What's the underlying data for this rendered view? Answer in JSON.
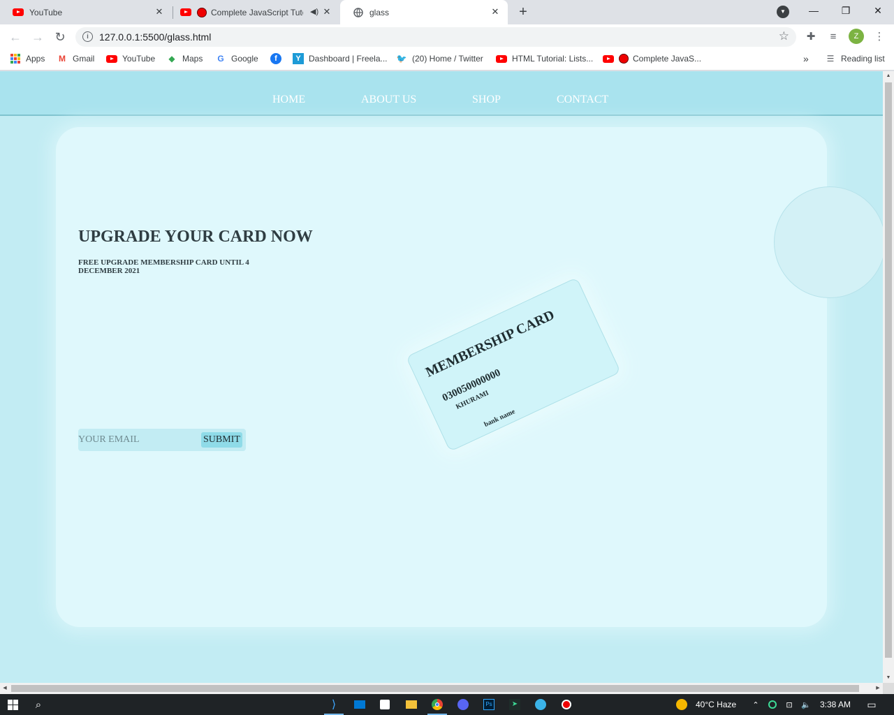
{
  "browser": {
    "tabs": [
      {
        "label": "YouTube",
        "icon": "youtube-icon"
      },
      {
        "label": "Complete JavaScript Tuto",
        "icon": "youtube-icon",
        "audio_icon": "speaker-icon"
      },
      {
        "label": "glass",
        "icon": "globe-icon",
        "active": true
      }
    ],
    "new_tab_symbol": "+",
    "url": "127.0.0.1:5500/glass.html",
    "profile_initial": "Z",
    "bookmarks": [
      {
        "label": "Apps",
        "icon": "apps-grid-icon"
      },
      {
        "label": "Gmail",
        "icon": "gmail-icon"
      },
      {
        "label": "YouTube",
        "icon": "youtube-icon"
      },
      {
        "label": "Maps",
        "icon": "maps-icon"
      },
      {
        "label": "Google",
        "icon": "google-icon"
      },
      {
        "label": "",
        "icon": "facebook-icon"
      },
      {
        "label": "Dashboard | Freela...",
        "icon": "freelancer-icon"
      },
      {
        "label": "(20) Home / Twitter",
        "icon": "twitter-icon"
      },
      {
        "label": "HTML Tutorial: Lists...",
        "icon": "youtube-icon"
      },
      {
        "label": "Complete JavaS...",
        "icon": "youtube-icon"
      }
    ],
    "bookmarks_overflow": "»",
    "reading_list": "Reading list"
  },
  "site": {
    "nav": [
      "HOME",
      "ABOUT US",
      "SHOP",
      "CONTACT"
    ],
    "headline": "UPGRADE YOUR CARD NOW",
    "subline": "FREE UPGRADE MEMBERSHIP CARD UNTIL 4 DECEMBER 2021",
    "email_placeholder": "YOUR EMAIL",
    "submit_label": "SUBMIT",
    "card": {
      "title": "MEMBERSHIP CARD",
      "number": "030050000000",
      "holder": "KHURAMI",
      "bank": "bank name"
    }
  },
  "taskbar": {
    "weather": "40°C  Haze",
    "time": "3:38 AM"
  },
  "colors": {
    "page_bg": "#c2ecf3",
    "nav_bg": "#a9e3ee",
    "glass_bg": "#dff8fc",
    "submit_bg": "#8fdbe8",
    "text_dark": "#2f3d42"
  }
}
